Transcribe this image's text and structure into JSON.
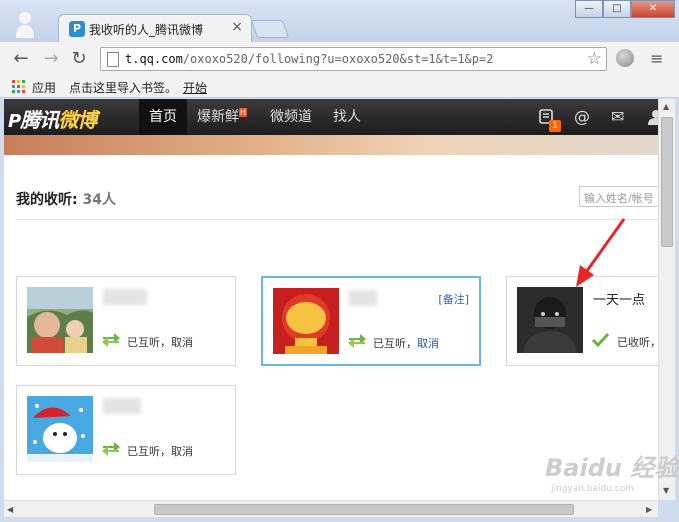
{
  "browser": {
    "tab_title": "我收听的人_腾讯微博",
    "tab_close": "×",
    "tab_favicon_letter": "P",
    "window_controls": [
      "—",
      "□",
      "✕"
    ],
    "url_host": "t.qq.com",
    "url_path": "/oxoxo520/following?u=oxoxo520&st=1&t=1&p=2",
    "back": "←",
    "forward": "→",
    "reload": "↻",
    "star": "☆",
    "menu": "≡",
    "bookmarks": {
      "apps": "应用",
      "import": "点击这里导入书签。",
      "start": "开始"
    }
  },
  "site": {
    "logo_mark": "P",
    "logo_text": "腾讯",
    "logo_weibo": "微博",
    "nav": [
      "首页",
      "爆新鲜",
      "微频道",
      "找人"
    ],
    "hot_badge": "H",
    "message_badge": "1",
    "icons": [
      "message-icon",
      "at-icon",
      "mail-icon",
      "user-icon"
    ],
    "at_symbol": "@",
    "mail_symbol": "✉"
  },
  "main": {
    "title_label": "我的收听:",
    "title_count": "34人",
    "search_placeholder": "输入姓名/帐号"
  },
  "cards": [
    {
      "name": "",
      "status": "已互听，",
      "action": "取消"
    },
    {
      "name": "",
      "note": "[备注]",
      "status": "已互听，",
      "action": "取消"
    },
    {
      "name": "一天一点",
      "status": "已收听，",
      "action": ""
    },
    {
      "name": "",
      "status": "已互听，",
      "action": "取消"
    }
  ],
  "watermark": {
    "main": "Baidu 经验",
    "sub": "jingyan.baidu.com"
  },
  "colors": {
    "accent": "#67b6e4",
    "mutual_icon": "#6cb33f",
    "badge": "#ff6600"
  }
}
